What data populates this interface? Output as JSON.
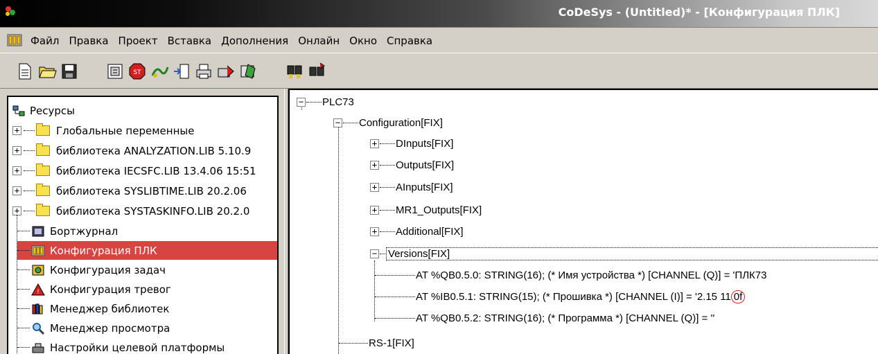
{
  "window": {
    "title": "CoDeSys - (Untitled)* - [Конфигурация ПЛК]"
  },
  "menu": {
    "items": [
      "Файл",
      "Правка",
      "Проект",
      "Вставка",
      "Дополнения",
      "Онлайн",
      "Окно",
      "Справка"
    ]
  },
  "toolbar": {
    "buttons": [
      "new-icon",
      "open-icon",
      "save-icon",
      "build-icon",
      "stop-icon",
      "run-icon",
      "step-icon",
      "print-icon",
      "export-icon",
      "settings-icon",
      "find-icon",
      "replace-icon"
    ]
  },
  "resources_tree": {
    "root": "Ресурсы",
    "items": [
      {
        "label": "Глобальные переменные",
        "type": "folder",
        "expandable": true
      },
      {
        "label": "библиотека ANALYZATION.LIB 5.10.9",
        "type": "folder",
        "expandable": true
      },
      {
        "label": "библиотека IECSFC.LIB 13.4.06 15:51",
        "type": "folder",
        "expandable": true
      },
      {
        "label": "библиотека SYSLIBTIME.LIB 20.2.06",
        "type": "folder",
        "expandable": true
      },
      {
        "label": "библиотека SYSTASKINFO.LIB 20.2.0",
        "type": "folder",
        "expandable": true
      },
      {
        "label": "Бортжурнал",
        "type": "item",
        "icon": "logbook-icon"
      },
      {
        "label": "Конфигурация ПЛК",
        "type": "item",
        "icon": "plc-config-icon",
        "selected": true
      },
      {
        "label": "Конфигурация задач",
        "type": "item",
        "icon": "task-config-icon"
      },
      {
        "label": "Конфигурация тревог",
        "type": "item",
        "icon": "alarm-config-icon"
      },
      {
        "label": "Менеджер библиотек",
        "type": "item",
        "icon": "library-manager-icon"
      },
      {
        "label": "Менеджер просмотра",
        "type": "item",
        "icon": "watch-manager-icon"
      },
      {
        "label": "Настройки целевой платформы",
        "type": "item",
        "icon": "target-settings-icon"
      }
    ]
  },
  "config_tree": {
    "root": "PLC73",
    "configuration": "Configuration[FIX]",
    "modules": [
      "DInputs[FIX]",
      "Outputs[FIX]",
      "AInputs[FIX]",
      "MR1_Outputs[FIX]",
      "Additional[FIX]"
    ],
    "versions": {
      "label": "Versions[FIX]",
      "channels": [
        "AT %QB0.5.0: STRING(16); (* Имя устройства *) [CHANNEL (Q)] = 'ПЛК73",
        "AT %IB0.5.1: STRING(15); (* Прошивка *) [CHANNEL (I)] = '2.15 11",
        "AT %QB0.5.2: STRING(16); (* Программа *) [CHANNEL (Q)] = ''"
      ],
      "firmware_suffix": "0f"
    },
    "rs1": "RS-1[FIX]"
  },
  "colors": {
    "selection": "#d64541",
    "annotation_circle": "#e02020"
  }
}
